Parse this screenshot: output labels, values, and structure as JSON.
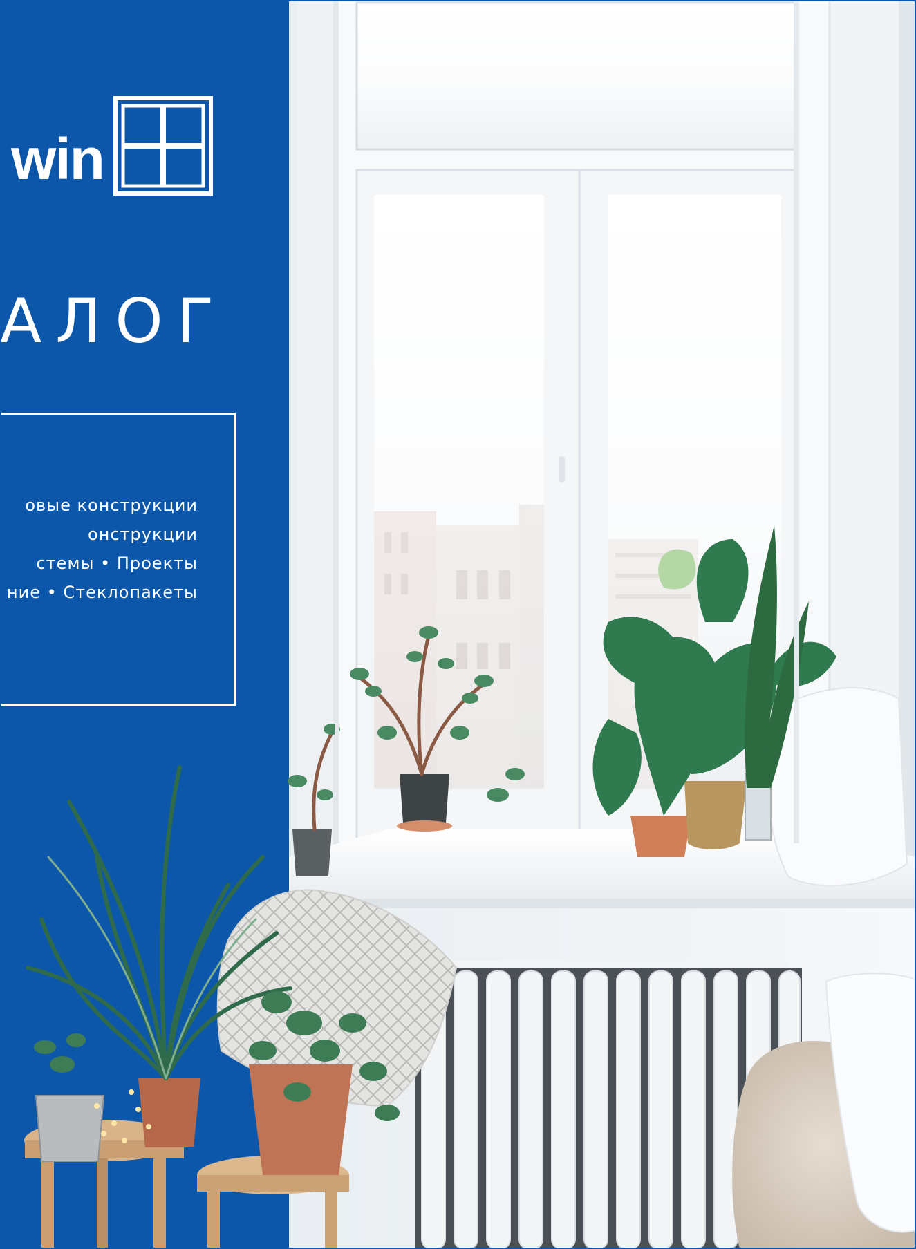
{
  "brand": {
    "wordmark": "win"
  },
  "cover": {
    "title": "АЛОГ",
    "features": [
      "овые конструкции",
      "онструкции",
      "стемы • Проекты",
      "ние • Стеклопакеты"
    ]
  },
  "colors": {
    "brand_blue": "#0d57aa",
    "white": "#ffffff"
  },
  "icons": {
    "logo": "window-grid-icon"
  }
}
